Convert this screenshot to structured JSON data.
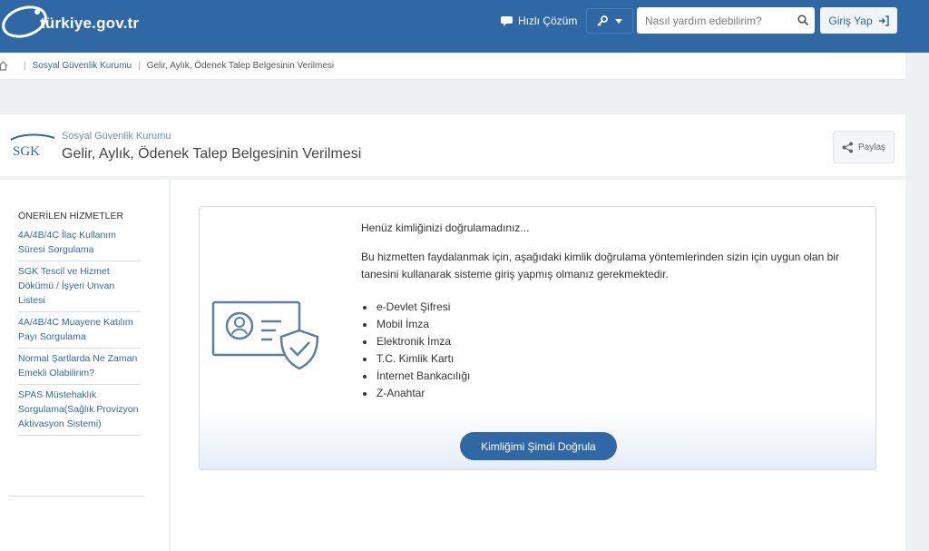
{
  "header": {
    "logo_text": "türkiye.gov.tr",
    "quick_solution_label": "Hızlı Çözüm",
    "search": {
      "placeholder": "Nasıl yardım edebilirim?"
    },
    "login_label": "Giriş Yap"
  },
  "breadcrumb": {
    "items": [
      "Sosyal Güvenlik Kurumu",
      "Gelir, Aylık, Ödenek Talep Belgesinin Verilmesi"
    ]
  },
  "service": {
    "logo_text": "SGK",
    "organization": "Sosyal Güvenlik Kurumu",
    "title": "Gelir, Aylık, Ödenek Talep Belgesinin Verilmesi",
    "share_label": "Paylaş"
  },
  "sidebar": {
    "title": "ÖNERİLEN HİZMETLER",
    "items": [
      "4A/4B/4C İlaç Kullanım Süresi Sorgulama",
      "SGK Tescil ve Hizmet Dökümü / İşyeri Unvan Listesi",
      "4A/4B/4C Muayene Katılım Payı Sorgulama",
      "Normal Şartlarda Ne Zaman Emekli Olabilirim?",
      "SPAS Müstehaklık Sorgulama(Sağlık Provizyon Aktivasyon Sistemi)"
    ]
  },
  "panel": {
    "heading": "Henüz kimliğinizi doğrulamadınız...",
    "description": "Bu hizmetten faydalanmak için, aşağıdaki kimlik doğrulama yöntemlerinden sizin için uygun olan bir tanesini kullanarak sisteme giriş yapmış olmanız gerekmektedir.",
    "methods": [
      "e-Devlet Şifresi",
      "Mobil İmza",
      "Elektronik İmza",
      "T.C. Kimlik Kartı",
      "İnternet Bankacılığı",
      "Z-Anahtar"
    ],
    "button_label": "Kimliğimi Şimdi Doğrula"
  },
  "colors": {
    "brand_blue": "#2f68a4",
    "link_blue": "#2f68a4",
    "page_bg": "#eef0f3"
  },
  "icons": [
    "home-icon",
    "chat-icon",
    "key-icon",
    "search-icon",
    "login-arrow-icon",
    "share-icon",
    "id-card-shield-icon"
  ]
}
